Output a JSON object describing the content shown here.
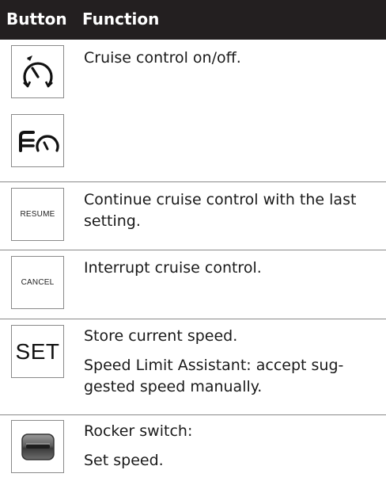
{
  "header": {
    "button_col": "Button",
    "function_col": "Function"
  },
  "rows": [
    {
      "icon": "cruise-control-icon",
      "lines": [
        "Cruise control on/off."
      ]
    },
    {
      "icon": "distance-cruise-icon",
      "lines": []
    },
    {
      "button_label": "RESUME",
      "lines": [
        "Continue cruise control with the last setting."
      ]
    },
    {
      "button_label": "CANCEL",
      "lines": [
        "Interrupt cruise control."
      ]
    },
    {
      "button_label": "SET",
      "lines": [
        "Store current speed.",
        "Speed Limit Assistant: accept sug-gested speed manually."
      ]
    },
    {
      "icon": "rocker-switch-icon",
      "lines": [
        "Rocker switch:",
        "Set speed."
      ]
    }
  ]
}
